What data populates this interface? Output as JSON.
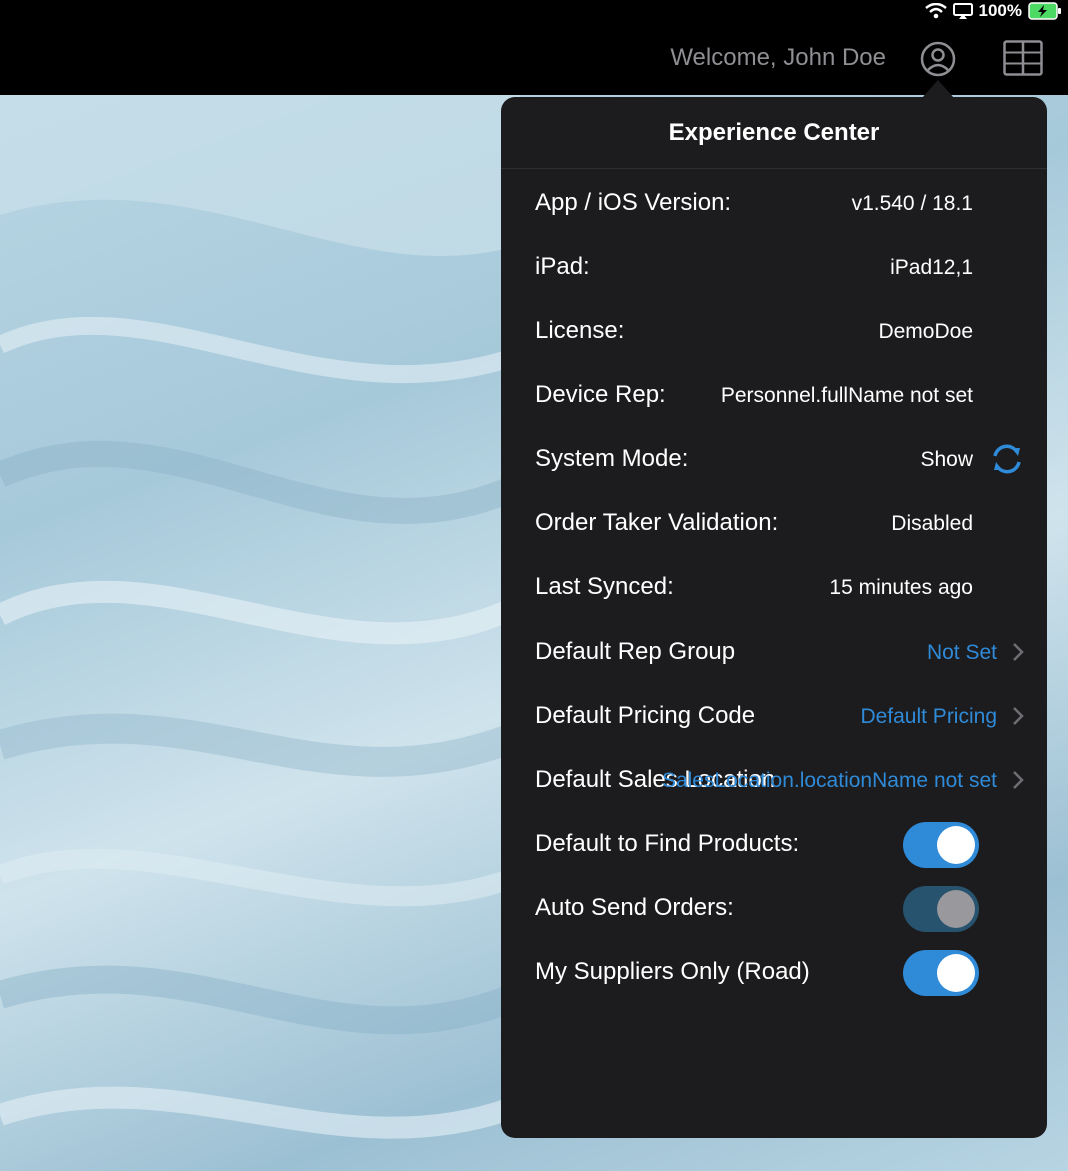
{
  "status": {
    "battery": "100%"
  },
  "header": {
    "welcome": "Welcome, John Doe"
  },
  "popover": {
    "title": "Experience Center",
    "rows": [
      {
        "label": "App / iOS Version:",
        "value": "v1.540 / 18.1"
      },
      {
        "label": "iPad:",
        "value": "iPad12,1"
      },
      {
        "label": "License:",
        "value": "DemoDoe"
      },
      {
        "label": "Device Rep:",
        "value": "Personnel.fullName not set"
      },
      {
        "label": "System Mode:",
        "value": "Show"
      },
      {
        "label": "Order Taker Validation:",
        "value": "Disabled"
      },
      {
        "label": "Last Synced:",
        "value": "15 minutes ago"
      },
      {
        "label": "Default Rep Group",
        "value": "Not Set"
      },
      {
        "label": "Default Pricing Code",
        "value": "Default Pricing"
      },
      {
        "label": "Default Sales Location",
        "value": "SalesLocation.locationName not set"
      },
      {
        "label": "Default to Find Products:",
        "value": "on"
      },
      {
        "label": "Auto Send Orders:",
        "value": "disabled"
      },
      {
        "label": "My Suppliers Only (Road)",
        "value": "on"
      }
    ]
  },
  "colors": {
    "accent": "#2f8ad8",
    "popover_bg": "#1c1c1e"
  }
}
